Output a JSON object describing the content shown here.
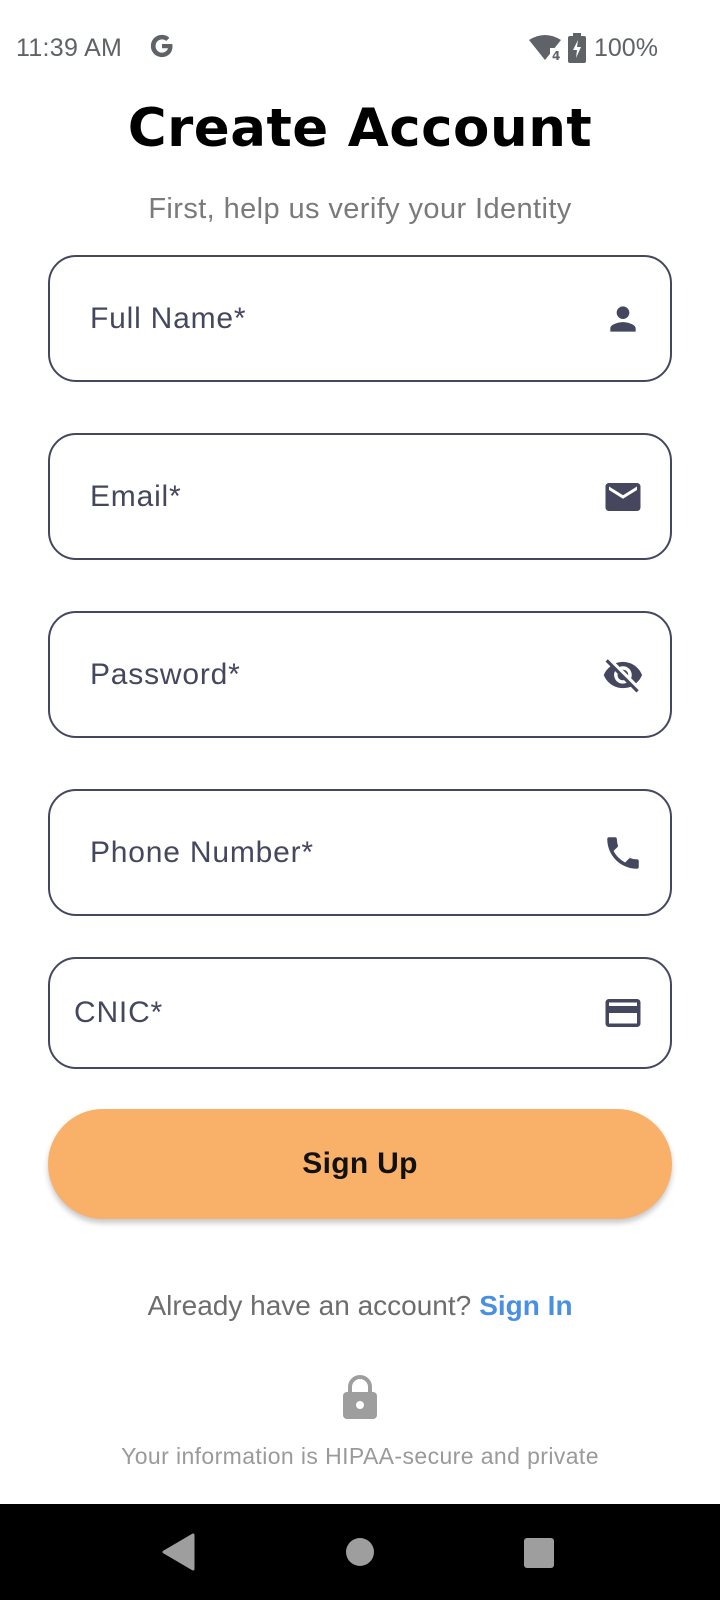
{
  "status_bar": {
    "time": "11:39 AM",
    "battery": "100%",
    "icons": [
      "google-icon",
      "wifi-icon",
      "battery-charging-icon"
    ]
  },
  "header": {
    "title": "Create Account",
    "subtitle": "First, help us verify your Identity"
  },
  "form": {
    "fields": [
      {
        "label": "Full Name*",
        "icon": "person-icon"
      },
      {
        "label": "Email*",
        "icon": "mail-icon"
      },
      {
        "label": "Password*",
        "icon": "visibility-off-icon"
      },
      {
        "label": "Phone Number*",
        "icon": "phone-icon"
      },
      {
        "label": "CNIC*",
        "icon": "card-icon"
      }
    ],
    "submit_label": "Sign Up"
  },
  "signin": {
    "prompt": "Already have an account?",
    "link": "Sign In"
  },
  "privacy": {
    "icon": "lock-icon",
    "note": "Your information is HIPAA-secure and private"
  },
  "colors": {
    "accent": "#f9b069",
    "link": "#4a90e2",
    "field_border": "#45475f",
    "title": "#000000"
  }
}
